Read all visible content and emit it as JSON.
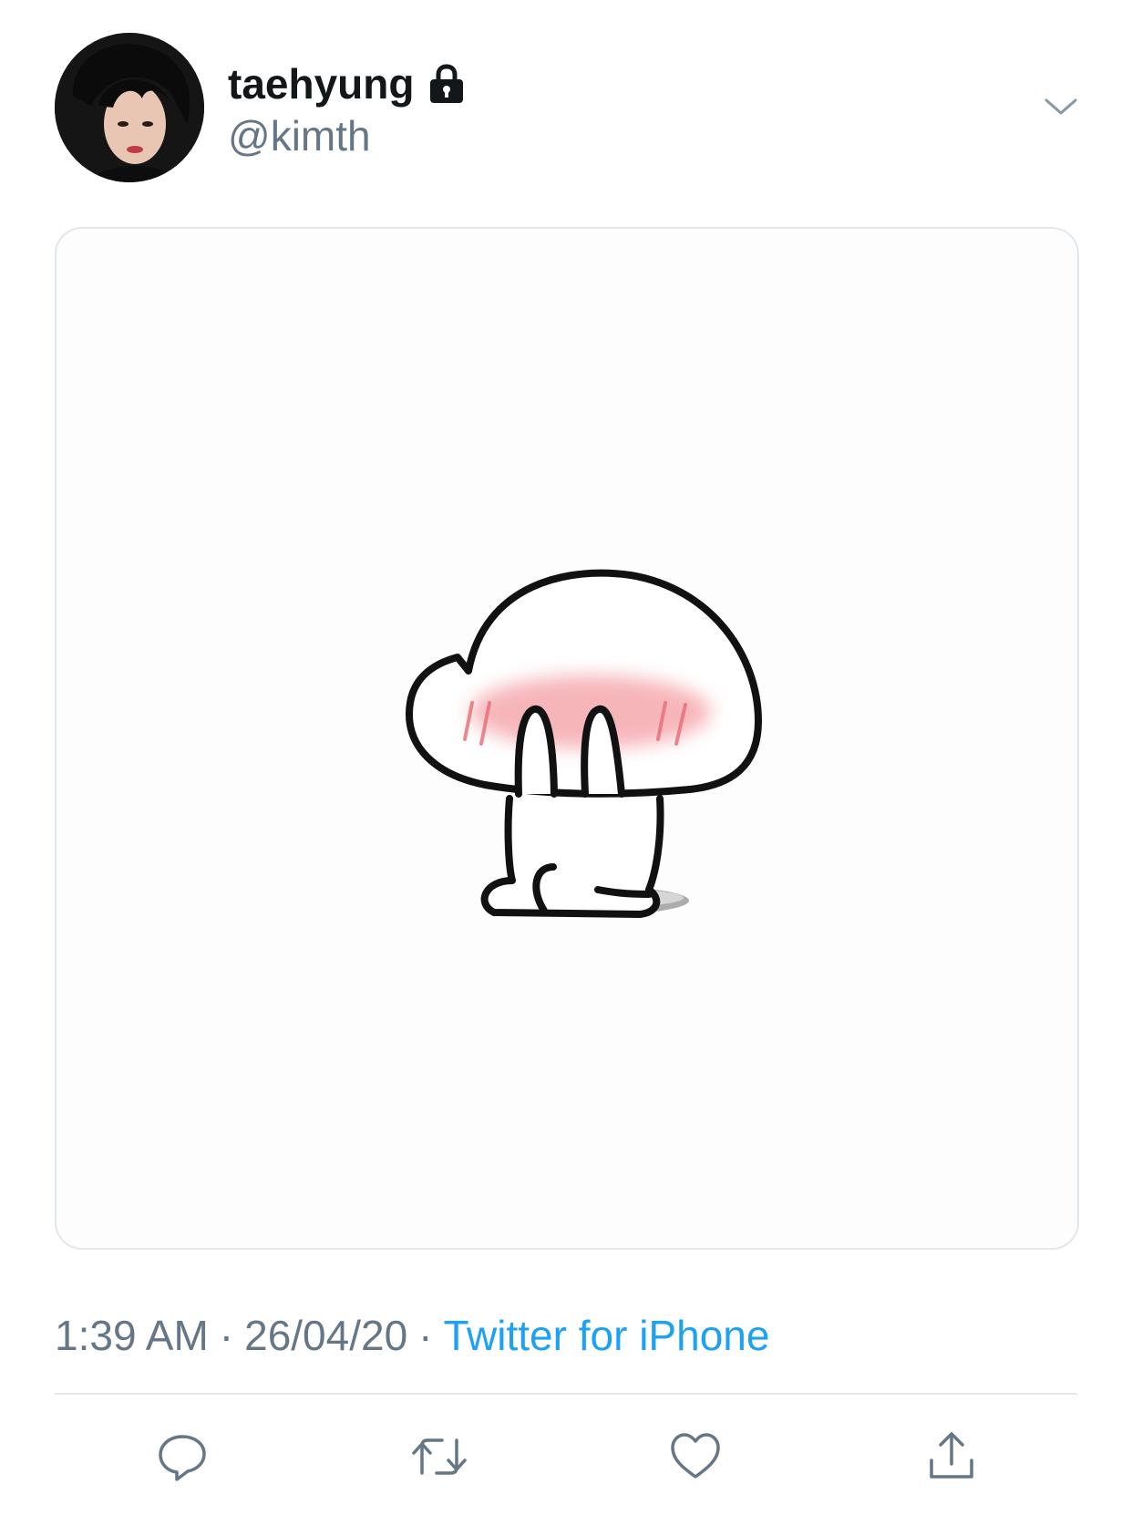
{
  "tweet": {
    "author": {
      "display_name": "taehyung",
      "handle": "@kimth",
      "protected_icon": "lock-icon",
      "avatar": "profile-photo"
    },
    "menu_icon": "chevron-down-icon",
    "media": {
      "kind": "sticker-illustration",
      "description_icon": "blushing-mushroom-character"
    },
    "meta": {
      "time": "1:39 AM",
      "separator": "·",
      "date": "26/04/20",
      "source": "Twitter for iPhone"
    },
    "actions": [
      {
        "icon": "reply-icon"
      },
      {
        "icon": "retweet-icon"
      },
      {
        "icon": "like-icon"
      },
      {
        "icon": "share-icon"
      }
    ]
  },
  "colors": {
    "text_primary": "#14171a",
    "text_secondary": "#657786",
    "link": "#1da1f2",
    "border": "#e1e8ed",
    "icon": "#657786",
    "blush": "#f4a3a8"
  }
}
